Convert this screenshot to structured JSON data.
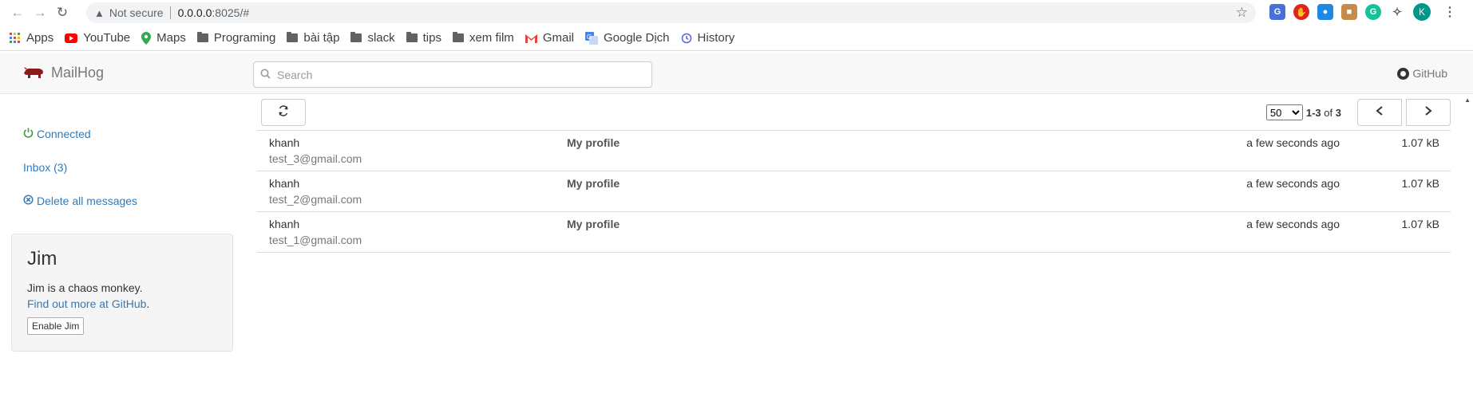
{
  "browser": {
    "security_label": "Not secure",
    "url_host": "0.0.0.0",
    "url_rest": ":8025/#",
    "profile_initial": "K"
  },
  "bookmarks": [
    {
      "label": "Apps",
      "icon": "apps-grid-icon"
    },
    {
      "label": "YouTube",
      "icon": "youtube-icon"
    },
    {
      "label": "Maps",
      "icon": "maps-icon"
    },
    {
      "label": "Programing",
      "icon": "folder-icon"
    },
    {
      "label": "bài tập",
      "icon": "folder-icon"
    },
    {
      "label": "slack",
      "icon": "folder-icon"
    },
    {
      "label": "tips",
      "icon": "folder-icon"
    },
    {
      "label": "xem film",
      "icon": "folder-icon"
    },
    {
      "label": "Gmail",
      "icon": "gmail-icon"
    },
    {
      "label": "Google Dịch",
      "icon": "google-translate-icon"
    },
    {
      "label": "History",
      "icon": "history-icon"
    }
  ],
  "app": {
    "brand": "MailHog",
    "search_placeholder": "Search",
    "github_label": "GitHub"
  },
  "sidebar": {
    "connected": "Connected",
    "inbox": "Inbox (3)",
    "delete_all": "Delete all messages"
  },
  "jim": {
    "title": "Jim",
    "text": "Jim is a chaos monkey.",
    "link_text": "Find out more at GitHub",
    "link_suffix": ".",
    "button": "Enable Jim"
  },
  "pager": {
    "page_size": "50",
    "range": "1-3",
    "of_label": "of",
    "total": "3"
  },
  "messages": [
    {
      "from": "khanh",
      "email": "test_3@gmail.com",
      "subject": "My profile",
      "time": "a few seconds ago",
      "size": "1.07 kB"
    },
    {
      "from": "khanh",
      "email": "test_2@gmail.com",
      "subject": "My profile",
      "time": "a few seconds ago",
      "size": "1.07 kB"
    },
    {
      "from": "khanh",
      "email": "test_1@gmail.com",
      "subject": "My profile",
      "time": "a few seconds ago",
      "size": "1.07 kB"
    }
  ],
  "colors": {
    "link": "#337ab7",
    "connected": "#3c9a3c",
    "brand_logo": "#8b1a1a"
  }
}
